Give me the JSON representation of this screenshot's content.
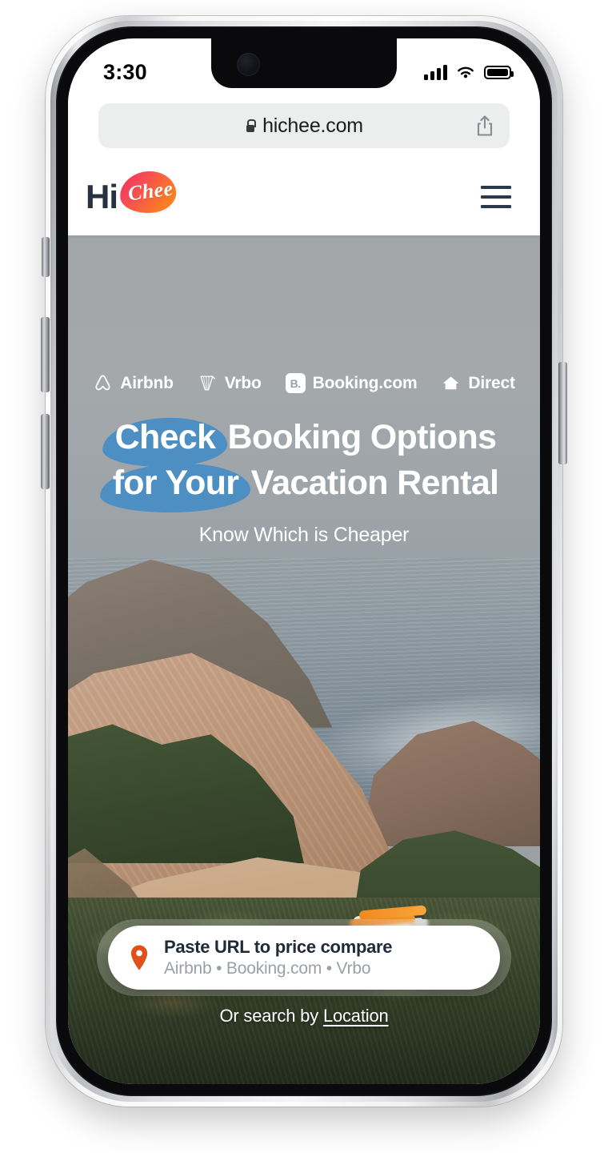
{
  "status_bar": {
    "time": "3:30",
    "signal_icon": "cellular-bars-icon",
    "wifi_icon": "wifi-icon",
    "battery_icon": "battery-icon"
  },
  "browser": {
    "lock_icon": "lock-icon",
    "url": "hichee.com",
    "share_icon": "share-icon"
  },
  "site_header": {
    "logo_primary": "Hi",
    "logo_script": "Chee",
    "menu_icon": "hamburger-menu-icon"
  },
  "hero": {
    "brands": [
      {
        "label": "Airbnb",
        "icon": "airbnb-belo-icon"
      },
      {
        "label": "Vrbo",
        "icon": "vrbo-icon"
      },
      {
        "label": "Booking.com",
        "icon": "booking-b-icon",
        "badge_text": "B."
      },
      {
        "label": "Direct",
        "icon": "house-icon"
      }
    ],
    "headline": {
      "line1_highlight": "Check",
      "line1_rest": "Booking Options",
      "line2_highlight": "for Your",
      "line2_rest": "Vacation Rental",
      "highlight_color": "#4e8fc3"
    },
    "subtitle": "Know Which is Cheaper",
    "search_card": {
      "pin_icon": "map-pin-icon",
      "pin_color": "#e0501a",
      "title": "Paste URL to price compare",
      "subtitle": "Airbnb • Booking.com • Vrbo"
    },
    "or_search_prefix": "Or search by ",
    "or_search_link": "Location"
  }
}
